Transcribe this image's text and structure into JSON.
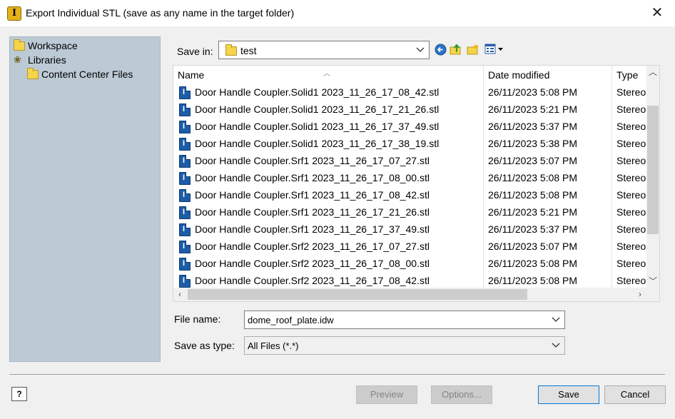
{
  "window": {
    "title": "Export Individual STL (save as any name in the target folder)",
    "app_icon_letter": "I",
    "close_glyph": "✕"
  },
  "places": [
    {
      "label": "Workspace",
      "icon": "folder-icon"
    },
    {
      "label": "Libraries",
      "icon": "library-icon"
    },
    {
      "label": "Content Center Files",
      "icon": "folder-icon"
    }
  ],
  "save_in": {
    "label": "Save in:",
    "value": "test"
  },
  "toolbar": {
    "icons": [
      "back-icon",
      "up-folder-icon",
      "new-folder-icon",
      "view-menu-icon"
    ]
  },
  "file_list": {
    "columns": [
      "Name",
      "Date modified",
      "Type"
    ],
    "rows": [
      {
        "name": "Door Handle Coupler.Solid1 2023_11_26_17_08_42.stl",
        "date": "26/11/2023 5:08 PM",
        "type": "Stereo"
      },
      {
        "name": "Door Handle Coupler.Solid1 2023_11_26_17_21_26.stl",
        "date": "26/11/2023 5:21 PM",
        "type": "Stereo"
      },
      {
        "name": "Door Handle Coupler.Solid1 2023_11_26_17_37_49.stl",
        "date": "26/11/2023 5:37 PM",
        "type": "Stereo"
      },
      {
        "name": "Door Handle Coupler.Solid1 2023_11_26_17_38_19.stl",
        "date": "26/11/2023 5:38 PM",
        "type": "Stereo"
      },
      {
        "name": "Door Handle Coupler.Srf1 2023_11_26_17_07_27.stl",
        "date": "26/11/2023 5:07 PM",
        "type": "Stereo"
      },
      {
        "name": "Door Handle Coupler.Srf1 2023_11_26_17_08_00.stl",
        "date": "26/11/2023 5:08 PM",
        "type": "Stereo"
      },
      {
        "name": "Door Handle Coupler.Srf1 2023_11_26_17_08_42.stl",
        "date": "26/11/2023 5:08 PM",
        "type": "Stereo"
      },
      {
        "name": "Door Handle Coupler.Srf1 2023_11_26_17_21_26.stl",
        "date": "26/11/2023 5:21 PM",
        "type": "Stereo"
      },
      {
        "name": "Door Handle Coupler.Srf1 2023_11_26_17_37_49.stl",
        "date": "26/11/2023 5:37 PM",
        "type": "Stereo"
      },
      {
        "name": "Door Handle Coupler.Srf2 2023_11_26_17_07_27.stl",
        "date": "26/11/2023 5:07 PM",
        "type": "Stereo"
      },
      {
        "name": "Door Handle Coupler.Srf2 2023_11_26_17_08_00.stl",
        "date": "26/11/2023 5:08 PM",
        "type": "Stereo"
      },
      {
        "name": "Door Handle Coupler.Srf2 2023_11_26_17_08_42.stl",
        "date": "26/11/2023 5:08 PM",
        "type": "Stereo"
      }
    ]
  },
  "file_name": {
    "label": "File name:",
    "value": "dome_roof_plate.idw"
  },
  "save_as_type": {
    "label": "Save as type:",
    "value": "All Files (*.*)"
  },
  "buttons": {
    "help": "?",
    "preview": "Preview",
    "options": "Options...",
    "save": "Save",
    "cancel": "Cancel"
  },
  "colors": {
    "places_bg": "#bccad6",
    "accent": "#0078d7",
    "stl_icon": "#1d5da8"
  }
}
